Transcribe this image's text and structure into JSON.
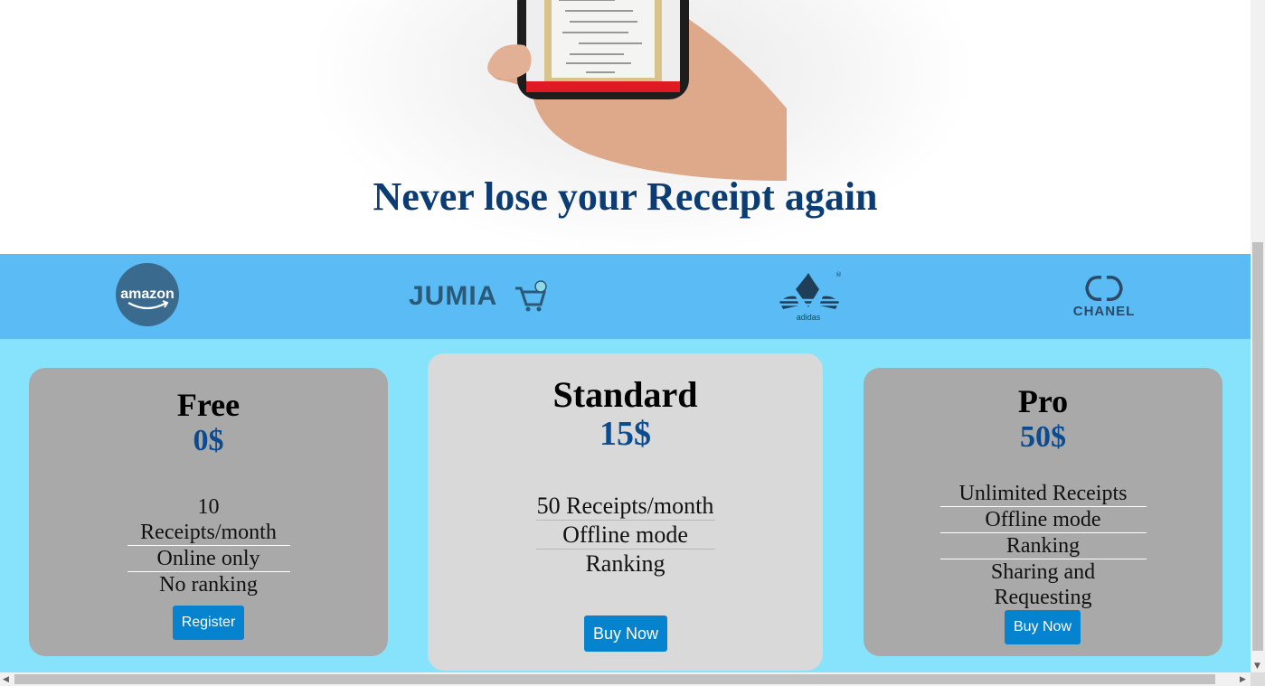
{
  "hero": {
    "title": "Never lose your Receipt again",
    "image_icon": "hand-holding-phone-with-receipt"
  },
  "brands": [
    {
      "name": "amazon",
      "label": "amazon"
    },
    {
      "name": "jumia",
      "label": "JUMIA"
    },
    {
      "name": "adidas",
      "label": "adidas"
    },
    {
      "name": "chanel",
      "label": "CHANEL"
    }
  ],
  "plans": {
    "free": {
      "name": "Free",
      "price": "0$",
      "features": [
        "10 Receipts/month",
        "Online only",
        "No ranking"
      ],
      "button": "Register"
    },
    "standard": {
      "name": "Standard",
      "price": "15$",
      "features": [
        "50 Receipts/month",
        "Offline mode",
        "Ranking"
      ],
      "button": "Buy Now"
    },
    "pro": {
      "name": "Pro",
      "price": "50$",
      "features": [
        "Unlimited Receipts",
        "Offline mode",
        "Ranking",
        "Sharing and Requesting"
      ],
      "button": "Buy Now"
    }
  },
  "colors": {
    "title": "#0b3d74",
    "price": "#0b4b8f",
    "brand_strip": "#5bbcf5",
    "pricing_bg": "#87e2fb",
    "button": "#0583cf"
  }
}
